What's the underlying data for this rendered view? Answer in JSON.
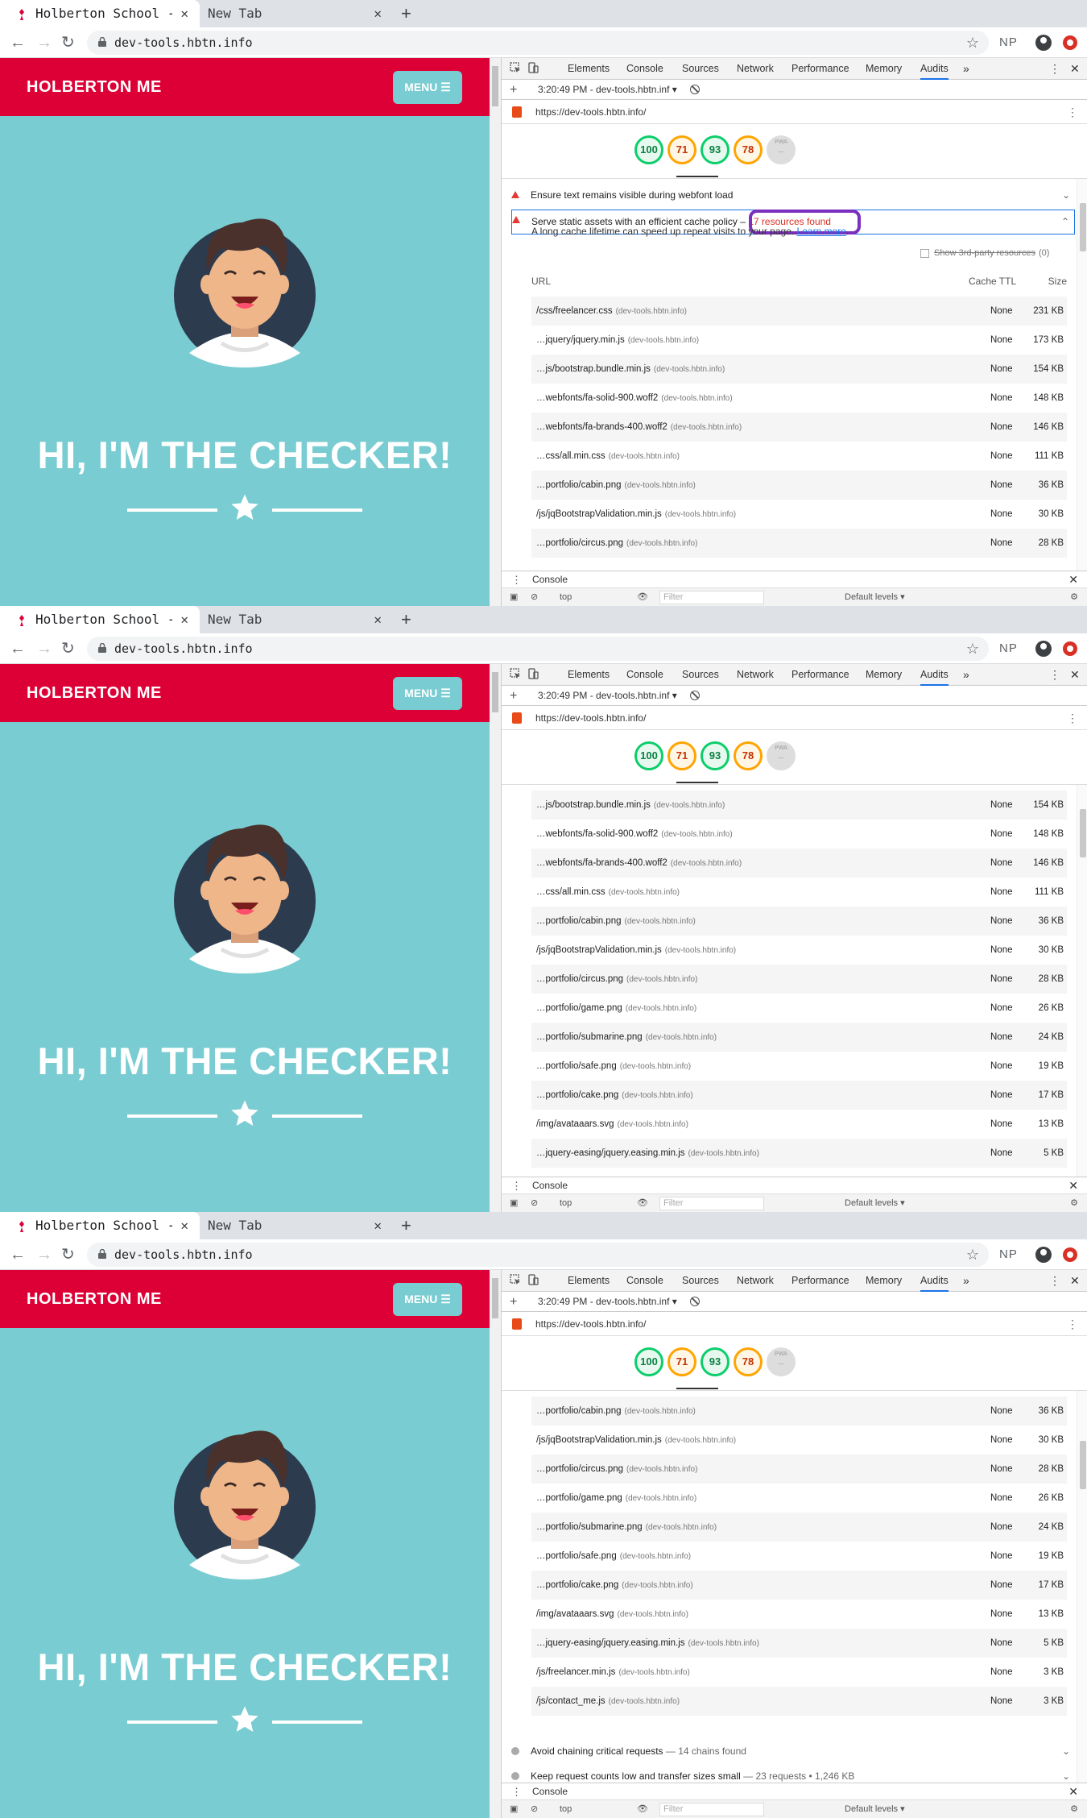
{
  "browser": {
    "active_tab": "Holberton School - ",
    "inactive_tab": "New Tab",
    "address": "dev-tools.hbtn.info",
    "profile": "NP"
  },
  "page": {
    "brand": "HOLBERTON ME",
    "menu_label": "MENU ☰",
    "heading": "HI, I'M THE CHECKER!"
  },
  "devtools": {
    "tabs": [
      "Elements",
      "Console",
      "Sources",
      "Network",
      "Performance",
      "Memory",
      "Audits"
    ],
    "report": "3:20:49 PM - dev-tools.hbtn.inf ▾",
    "url": "https://dev-tools.hbtn.info/",
    "scores": [
      {
        "value": "100",
        "color": "green"
      },
      {
        "value": "71",
        "color": "orange"
      },
      {
        "value": "93",
        "color": "green"
      },
      {
        "value": "78",
        "color": "orange"
      },
      {
        "value": "PWA",
        "color": "gray"
      }
    ],
    "audit_webfont": "Ensure text remains visible during webfont load",
    "audit_cache": "Serve static assets with an efficient cache policy",
    "audit_cache_count": "17 resources found",
    "description": "A long cache lifetime can speed up repeat visits to your page.",
    "learn_more": "Learn more",
    "third_party": "Show 3rd-party resources",
    "third_party_count": "(0)",
    "col_url": "URL",
    "col_ttl": "Cache TTL",
    "col_size": "Size",
    "resources": [
      {
        "url": "/css/freelancer.css",
        "host": "(dev-tools.hbtn.info)",
        "ttl": "None",
        "size": "231 KB"
      },
      {
        "url": "…jquery/jquery.min.js",
        "host": "(dev-tools.hbtn.info)",
        "ttl": "None",
        "size": "173 KB"
      },
      {
        "url": "…js/bootstrap.bundle.min.js",
        "host": "(dev-tools.hbtn.info)",
        "ttl": "None",
        "size": "154 KB"
      },
      {
        "url": "…webfonts/fa-solid-900.woff2",
        "host": "(dev-tools.hbtn.info)",
        "ttl": "None",
        "size": "148 KB"
      },
      {
        "url": "…webfonts/fa-brands-400.woff2",
        "host": "(dev-tools.hbtn.info)",
        "ttl": "None",
        "size": "146 KB"
      },
      {
        "url": "…css/all.min.css",
        "host": "(dev-tools.hbtn.info)",
        "ttl": "None",
        "size": "111 KB"
      },
      {
        "url": "…portfolio/cabin.png",
        "host": "(dev-tools.hbtn.info)",
        "ttl": "None",
        "size": "36 KB"
      },
      {
        "url": "/js/jqBootstrapValidation.min.js",
        "host": "(dev-tools.hbtn.info)",
        "ttl": "None",
        "size": "30 KB"
      },
      {
        "url": "…portfolio/circus.png",
        "host": "(dev-tools.hbtn.info)",
        "ttl": "None",
        "size": "28 KB"
      },
      {
        "url": "…portfolio/game.png",
        "host": "(dev-tools.hbtn.info)",
        "ttl": "None",
        "size": "26 KB"
      },
      {
        "url": "…portfolio/submarine.png",
        "host": "(dev-tools.hbtn.info)",
        "ttl": "None",
        "size": "24 KB"
      },
      {
        "url": "…portfolio/safe.png",
        "host": "(dev-tools.hbtn.info)",
        "ttl": "None",
        "size": "19 KB"
      },
      {
        "url": "…portfolio/cake.png",
        "host": "(dev-tools.hbtn.info)",
        "ttl": "None",
        "size": "17 KB"
      },
      {
        "url": "/img/avataaars.svg",
        "host": "(dev-tools.hbtn.info)",
        "ttl": "None",
        "size": "13 KB"
      },
      {
        "url": "…jquery-easing/jquery.easing.min.js",
        "host": "(dev-tools.hbtn.info)",
        "ttl": "None",
        "size": "5 KB"
      },
      {
        "url": "/js/freelancer.min.js",
        "host": "(dev-tools.hbtn.info)",
        "ttl": "None",
        "size": "3 KB"
      },
      {
        "url": "/js/contact_me.js",
        "host": "(dev-tools.hbtn.info)",
        "ttl": "None",
        "size": "3 KB"
      }
    ],
    "audit_chains": "Avoid chaining critical requests",
    "audit_chains_sub": "— 14 chains found",
    "audit_requests": "Keep request counts low and transfer sizes small",
    "audit_requests_sub": "— 23 requests • 1,246 KB",
    "drawer_label": "Console",
    "context": "top",
    "filter_placeholder": "Filter",
    "levels": "Default levels ▾"
  },
  "icons": [
    "favicon-icon",
    "close-icon",
    "new-tab-icon",
    "back-icon",
    "forward-icon",
    "reload-icon",
    "lock-icon",
    "star-icon",
    "account-icon",
    "extension-icon",
    "inspect-icon",
    "device-icon",
    "more-tabs-icon",
    "kebab-icon",
    "warning-icon",
    "chevron-icon",
    "block-icon",
    "audit-icon"
  ],
  "colors": {
    "brand_red": "#dd0036",
    "page_teal": "#79ccd1",
    "pass_green": "#0cce6b",
    "avg_orange": "#ffa400",
    "fail_red": "#e53935",
    "highlight_purple": "#7b2fbe"
  }
}
